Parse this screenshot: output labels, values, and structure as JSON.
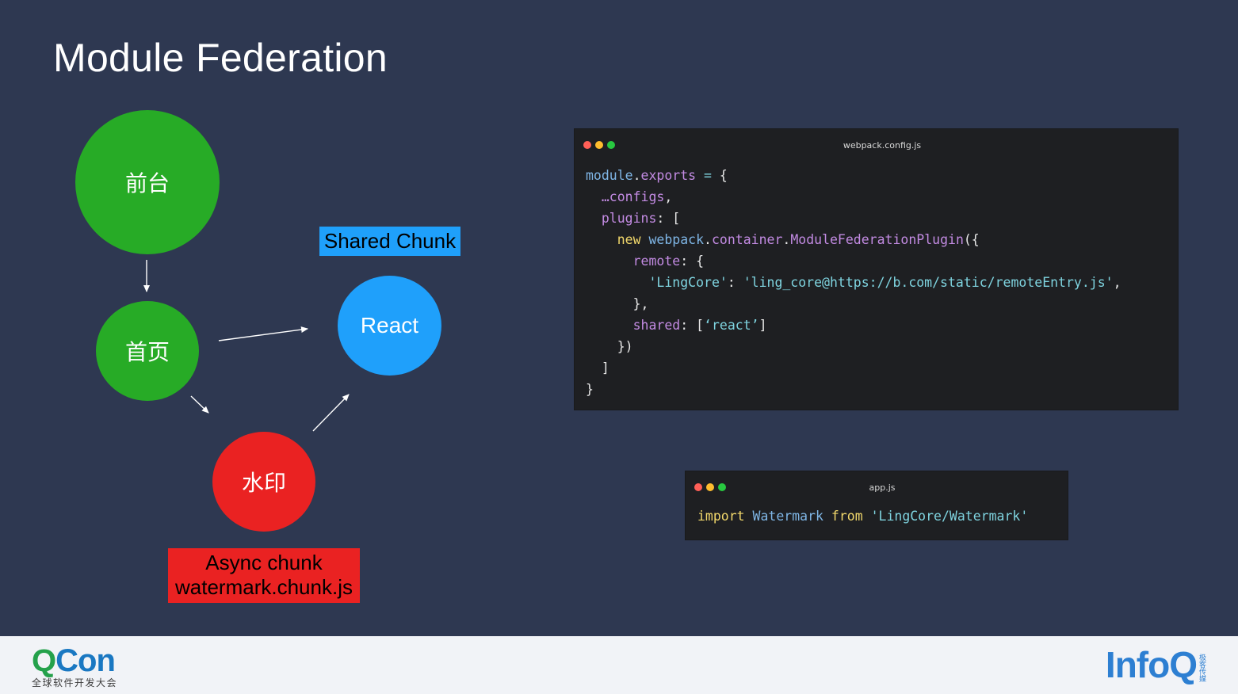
{
  "slide": {
    "title": "Module Federation"
  },
  "diagram": {
    "nodes": [
      {
        "id": "qiantai",
        "label": "前台",
        "color": "#27ab26"
      },
      {
        "id": "shouye",
        "label": "首页",
        "color": "#27ab26"
      },
      {
        "id": "react",
        "label": "React",
        "color": "#1fa0fb"
      },
      {
        "id": "shuiyin",
        "label": "水印",
        "color": "#ea2222"
      }
    ],
    "shared_label": "Shared Chunk",
    "async_label": {
      "line1": "Async chunk",
      "line2": "watermark.chunk.js"
    },
    "colors": {
      "shared_tag": "#1fa0fb",
      "async_tag": "#ea2222",
      "arrow": "#ffffff"
    }
  },
  "code_windows": {
    "config": {
      "filename": "webpack.config.js",
      "lines": [
        [
          [
            "ident",
            "module"
          ],
          [
            "plain",
            "."
          ],
          [
            "prop",
            "exports"
          ],
          [
            "plain",
            " "
          ],
          [
            "str",
            "="
          ],
          [
            "plain",
            " {"
          ]
        ],
        [
          [
            "plain",
            "  "
          ],
          [
            "prop",
            "…configs"
          ],
          [
            "plain",
            ","
          ]
        ],
        [
          [
            "plain",
            "  "
          ],
          [
            "prop",
            "plugins"
          ],
          [
            "plain",
            ": ["
          ]
        ],
        [
          [
            "plain",
            "    "
          ],
          [
            "kw",
            "new"
          ],
          [
            "plain",
            " "
          ],
          [
            "ident",
            "webpack"
          ],
          [
            "plain",
            "."
          ],
          [
            "prop",
            "container"
          ],
          [
            "plain",
            "."
          ],
          [
            "prop",
            "ModuleFederationPlugin"
          ],
          [
            "plain",
            "({"
          ]
        ],
        [
          [
            "plain",
            "      "
          ],
          [
            "prop",
            "remote"
          ],
          [
            "plain",
            ": {"
          ]
        ],
        [
          [
            "plain",
            "        "
          ],
          [
            "str",
            "'LingCore'"
          ],
          [
            "plain",
            ": "
          ],
          [
            "str",
            "'ling_core@https://b.com/static/remoteEntry.js'"
          ],
          [
            "plain",
            ","
          ]
        ],
        [
          [
            "plain",
            "      },"
          ]
        ],
        [
          [
            "plain",
            "      "
          ],
          [
            "prop",
            "shared"
          ],
          [
            "plain",
            ": ["
          ],
          [
            "str",
            "‘react’"
          ],
          [
            "plain",
            "]"
          ]
        ],
        [
          [
            "plain",
            "    })"
          ]
        ],
        [
          [
            "plain",
            "  ]"
          ]
        ],
        [
          [
            "plain",
            "}"
          ]
        ]
      ]
    },
    "app": {
      "filename": "app.js",
      "lines": [
        [
          [
            "kw",
            "import"
          ],
          [
            "plain",
            " "
          ],
          [
            "ident",
            "Watermark"
          ],
          [
            "plain",
            " "
          ],
          [
            "kw",
            "from"
          ],
          [
            "plain",
            " "
          ],
          [
            "str",
            "'LingCore/Watermark'"
          ]
        ]
      ]
    }
  },
  "footer": {
    "qcon_q": "Q",
    "qcon_con": "Con",
    "qcon_subtitle": "全球软件开发大会",
    "infoq": "InfoQ",
    "infoq_sub": "极客传媒"
  },
  "theme": {
    "background": "#2e3851",
    "code_bg": "#1e1f22",
    "footer_bg": "#f1f3f7"
  }
}
